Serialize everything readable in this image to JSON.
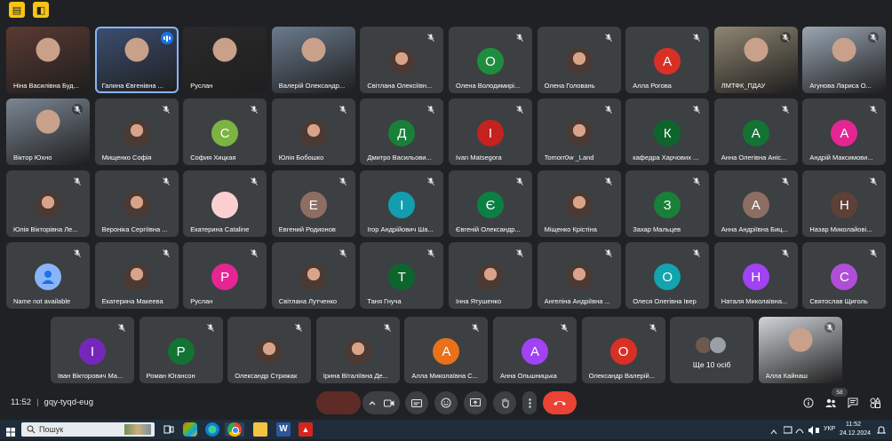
{
  "topbar": {
    "icons": [
      {
        "name": "presentation-icon",
        "glyph": "▤"
      },
      {
        "name": "activities-icon",
        "glyph": "◧"
      }
    ]
  },
  "colors": {
    "background": "#202124",
    "tile": "#3c4043",
    "hangup": "#ea4335",
    "mic_off": "#f28b82"
  },
  "participants": [
    {
      "name": "Ніна Василівна Буд...",
      "type": "video",
      "video_color": "#5b3a32",
      "speaking": false
    },
    {
      "name": "Галина Євгенівна ...",
      "type": "video",
      "video_color": "#3d4f73",
      "speaking": true,
      "active": true
    },
    {
      "name": "Руслан",
      "type": "video",
      "video_color": "#2b2b2b",
      "speaking": false
    },
    {
      "name": "Валерій Олександр...",
      "type": "video",
      "video_color": "#6b7b8e",
      "speaking": false
    },
    {
      "name": "Світлана Олексіївн...",
      "type": "photo"
    },
    {
      "name": "Олена Володимирі...",
      "type": "letter",
      "letter": "О",
      "color": "#1e8e3e"
    },
    {
      "name": "Олена Головань",
      "type": "photo"
    },
    {
      "name": "Алла Рогова",
      "type": "letter",
      "letter": "А",
      "color": "#d93025"
    },
    {
      "name": "ЛМТФК_ПДАУ",
      "type": "video",
      "video_color": "#8f8672",
      "speaking": false
    },
    {
      "name": "Агунова Лариса О...",
      "type": "video",
      "video_color": "#9aa6b3",
      "speaking": false
    },
    {
      "name": "Віктор Юхно",
      "type": "video",
      "video_color": "#7b8794",
      "speaking": false
    },
    {
      "name": "Мищенко Софія",
      "type": "photo"
    },
    {
      "name": "София Хицкая",
      "type": "letter",
      "letter": "С",
      "color": "#7cb342"
    },
    {
      "name": "Юлія Бобошко",
      "type": "photo"
    },
    {
      "name": "Дмитро Васильови...",
      "type": "letter",
      "letter": "Д",
      "color": "#188038"
    },
    {
      "name": "Ivan Matsegora",
      "type": "letter",
      "letter": "I",
      "color": "#c5221f"
    },
    {
      "name": "Tomorr0w _Land",
      "type": "photo"
    },
    {
      "name": "кафедра Харчових ...",
      "type": "letter",
      "letter": "К",
      "color": "#0d652d"
    },
    {
      "name": "Анна Олегівна Аніс...",
      "type": "letter",
      "letter": "А",
      "color": "#137333"
    },
    {
      "name": "Андрій Максимови...",
      "type": "letter",
      "letter": "А",
      "color": "#e52592"
    },
    {
      "name": "Юлія Вікторівна Ле...",
      "type": "photo"
    },
    {
      "name": "Вероніка Сергіївна ...",
      "type": "photo"
    },
    {
      "name": "Екатерина Cataline",
      "type": "letter",
      "letter": "",
      "color": "#fbcfd0"
    },
    {
      "name": "Евгений Родионов",
      "type": "letter",
      "letter": "Е",
      "color": "#8d6e63"
    },
    {
      "name": "Ігор Андрійович Ша...",
      "type": "letter",
      "letter": "І",
      "color": "#129eaf"
    },
    {
      "name": "Євгеній Олександр...",
      "type": "letter",
      "letter": "Є",
      "color": "#0b8043"
    },
    {
      "name": "Міщенко Крістіна",
      "type": "photo"
    },
    {
      "name": "Захар Мальцев",
      "type": "letter",
      "letter": "З",
      "color": "#188038"
    },
    {
      "name": "Анна Андріївна Биц...",
      "type": "letter",
      "letter": "А",
      "color": "#8d6e63"
    },
    {
      "name": "Назар Миколайові...",
      "type": "letter",
      "letter": "Н",
      "color": "#5d4037"
    },
    {
      "name": "Name not available",
      "type": "generic"
    },
    {
      "name": "Екатерина Макеева",
      "type": "photo"
    },
    {
      "name": "Руслан",
      "type": "letter",
      "letter": "Р",
      "color": "#e52592"
    },
    {
      "name": "Світлана Лутченко",
      "type": "photo"
    },
    {
      "name": "Таня Гнуча",
      "type": "letter",
      "letter": "Т",
      "color": "#0d652d"
    },
    {
      "name": "Інна Ятушенко",
      "type": "photo"
    },
    {
      "name": "Ангеліна Андріївна ...",
      "type": "photo"
    },
    {
      "name": "Олеся Олегівна Івер",
      "type": "letter",
      "letter": "О",
      "color": "#12a4af"
    },
    {
      "name": "Наталя Миколаївна...",
      "type": "letter",
      "letter": "Н",
      "color": "#a142f4"
    },
    {
      "name": "Святослав Щиголь",
      "type": "letter",
      "letter": "С",
      "color": "#b04fd6"
    },
    {
      "name": "Іван Вікторович Ма...",
      "type": "letter",
      "letter": "І",
      "color": "#7627bb"
    },
    {
      "name": "Роман Югансон",
      "type": "letter",
      "letter": "Р",
      "color": "#137333"
    },
    {
      "name": "Олександр Стрижак",
      "type": "photo"
    },
    {
      "name": "Ірина Віталіївна Де...",
      "type": "photo"
    },
    {
      "name": "Алла Миколаївна С...",
      "type": "letter",
      "letter": "А",
      "color": "#e8711a"
    },
    {
      "name": "Анна Ольшницька",
      "type": "letter",
      "letter": "А",
      "color": "#a142f4"
    },
    {
      "name": "Олександр Валерій...",
      "type": "letter",
      "letter": "О",
      "color": "#d93025"
    },
    {
      "name": "Ще 10 осіб",
      "type": "more"
    },
    {
      "name": "Алла Кайнаш",
      "type": "video",
      "video_color": "#cfd4d8",
      "speaking": false
    }
  ],
  "meeting": {
    "time": "11:52",
    "separator": "|",
    "code": "gqy-tyqd-eug"
  },
  "controls": {
    "participant_count": "58"
  },
  "taskbar": {
    "search_placeholder": "Пошук",
    "language": "УКР",
    "time": "11:52",
    "date": "24.12.2024"
  }
}
